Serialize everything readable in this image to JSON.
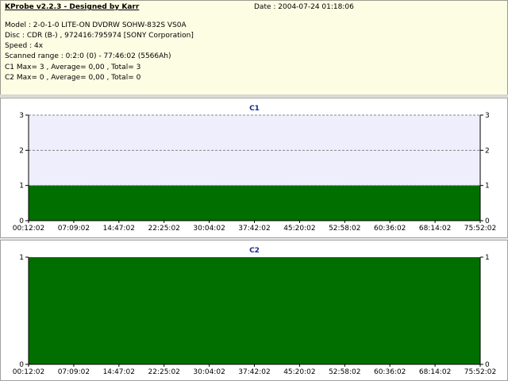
{
  "header": {
    "app_title": "KProbe v2.2.3 - Designed by Karr",
    "date": "Date : 2004-07-24 01:18:06",
    "model": "Model : 2-0-1-0 LITE-ON DVDRW SOHW-832S  VS0A",
    "disc": "Disc : CDR (B-) , 972416:795974 [SONY Corporation]",
    "speed": "Speed : 4x",
    "scanned_range": "Scanned range : 0:2:0 (0) - 77:46:02 (5566Ah)",
    "c1_stats": "C1 Max= 3 , Average= 0,00 , Total= 3",
    "c2_stats": "C2 Max= 0 , Average= 0,00 , Total= 0"
  },
  "colors": {
    "bar_fill": "#006f00",
    "plot_bg_c1": "#eeeefc",
    "plot_bg_c2": "#ffffff",
    "title": "#1a2a88",
    "grid": "#888888"
  },
  "chart_data": [
    {
      "type": "area",
      "title": "C1",
      "x_ticks": [
        "00:12:02",
        "07:09:02",
        "14:47:02",
        "22:25:02",
        "30:04:02",
        "37:42:02",
        "45:20:02",
        "52:58:02",
        "60:36:02",
        "68:14:02",
        "75:52:02"
      ],
      "y_ticks": [
        0,
        1,
        2,
        3
      ],
      "ylim": [
        0,
        3
      ],
      "values": [
        1,
        1,
        1,
        1,
        1,
        1,
        1,
        1,
        1,
        1,
        1
      ],
      "grid": true,
      "legend": "none"
    },
    {
      "type": "area",
      "title": "C2",
      "x_ticks": [
        "00:12:02",
        "07:09:02",
        "14:47:02",
        "22:25:02",
        "30:04:02",
        "37:42:02",
        "45:20:02",
        "52:58:02",
        "60:36:02",
        "68:14:02",
        "75:52:02"
      ],
      "y_ticks": [
        0,
        1
      ],
      "ylim": [
        0,
        1
      ],
      "values": [
        1,
        1,
        1,
        1,
        1,
        1,
        1,
        1,
        1,
        1,
        1
      ],
      "grid": false,
      "legend": "none"
    }
  ]
}
